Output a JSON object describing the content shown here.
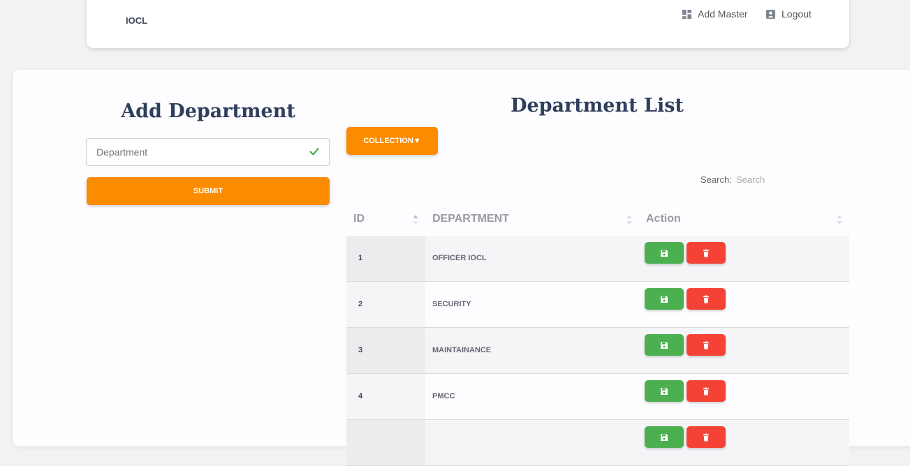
{
  "navbar": {
    "brand": "IOCL",
    "add_master_label": "Add Master",
    "logout_label": "Logout"
  },
  "form": {
    "title": "Add Department",
    "input_placeholder": "Department",
    "input_value": "",
    "submit_label": "SUBMIT"
  },
  "list": {
    "title": "Department List",
    "collection_label": "COLLECTION▼",
    "search_label": "Search:",
    "search_placeholder": "Search",
    "columns": [
      "ID",
      "DEPARTMENT",
      "Action"
    ],
    "rows": [
      {
        "id": "1",
        "department": "OFFICER IOCL"
      },
      {
        "id": "2",
        "department": "SECURITY"
      },
      {
        "id": "3",
        "department": "MAINTAINANCE"
      },
      {
        "id": "4",
        "department": "PMCC"
      },
      {
        "id": "",
        "department": ""
      }
    ]
  },
  "colors": {
    "accent": "#fb8c00",
    "save": "#4caf50",
    "delete": "#f44336",
    "valid_check": "#4caf50"
  },
  "icons": {
    "add_master": "dashboard-icon",
    "logout": "account-box-icon",
    "valid": "check-icon",
    "save": "floppy-icon",
    "delete": "trash-icon"
  }
}
